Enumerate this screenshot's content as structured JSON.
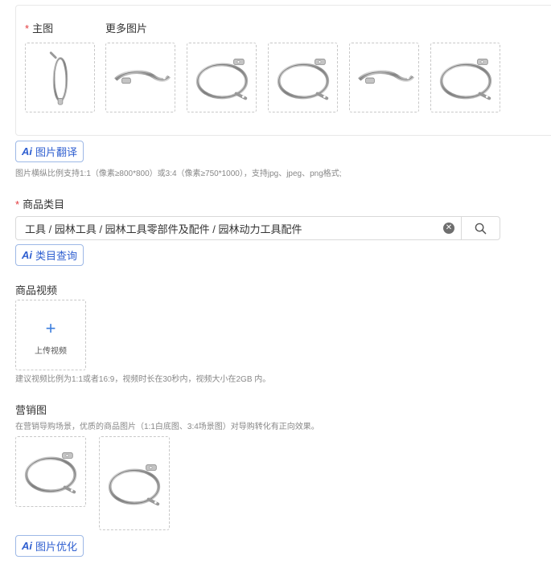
{
  "images": {
    "main_label": "主图",
    "required_mark": "*",
    "more_label": "更多图片",
    "thumbs": [
      {
        "name": "main-image",
        "icon": "ring-clamp-icon"
      },
      {
        "name": "more-image-1",
        "icon": "band-clamp-icon"
      },
      {
        "name": "more-image-2",
        "icon": "ring-clamp-icon"
      },
      {
        "name": "more-image-3",
        "icon": "ring-clamp-icon"
      },
      {
        "name": "more-image-4",
        "icon": "band-clamp-icon"
      },
      {
        "name": "more-image-5",
        "icon": "ring-clamp-icon"
      }
    ],
    "translate_button": {
      "badge": "Ai",
      "label": "图片翻译"
    },
    "hint": "图片横纵比例支持1:1（像素≥800*800）或3:4（像素≥750*1000），支持jpg、jpeg、png格式;"
  },
  "category": {
    "required_mark": "*",
    "label": "商品类目",
    "value": "工具 / 园林工具 / 园林工具零部件及配件 / 园林动力工具配件",
    "query_button": {
      "badge": "Ai",
      "label": "类目查询"
    }
  },
  "video": {
    "label": "商品视频",
    "upload_label": "上传视频",
    "plus": "+",
    "hint": "建议视频比例为1:1或者16:9，视频时长在30秒内，视频大小在2GB 内。"
  },
  "marketing": {
    "label": "营销图",
    "hint": "在营销导购场景，优质的商品图片（1:1白底图、3:4场景图）对导购转化有正向效果。",
    "optimize_button": {
      "badge": "Ai",
      "label": "图片优化"
    }
  },
  "colors": {
    "accent": "#2f5fd0",
    "required": "#e4393c",
    "border": "#c8c8c8"
  }
}
